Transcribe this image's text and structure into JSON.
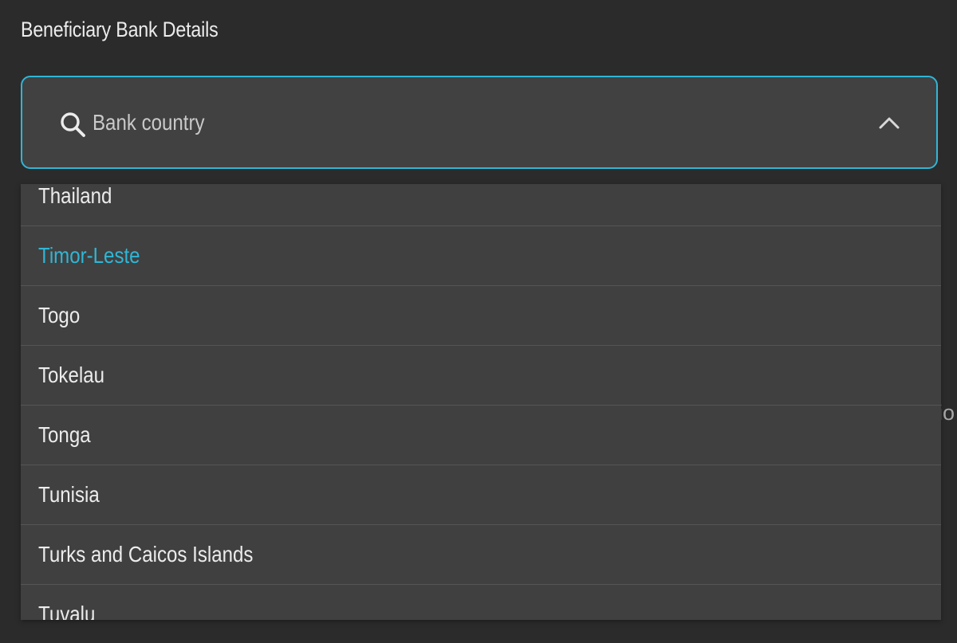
{
  "section": {
    "title": "Beneficiary Bank Details"
  },
  "search": {
    "placeholder": "Bank country",
    "value": "",
    "icon": "search-icon",
    "toggle_icon": "chevron-up-icon",
    "accent_color": "#2fb6d6"
  },
  "dropdown": {
    "selected": "Timor-Leste",
    "items": [
      {
        "label": "Thailand",
        "selected": false
      },
      {
        "label": "Timor-Leste",
        "selected": true
      },
      {
        "label": "Togo",
        "selected": false
      },
      {
        "label": "Tokelau",
        "selected": false
      },
      {
        "label": "Tonga",
        "selected": false
      },
      {
        "label": "Tunisia",
        "selected": false
      },
      {
        "label": "Turks and Caicos Islands",
        "selected": false
      },
      {
        "label": "Tuvalu",
        "selected": false
      }
    ]
  },
  "background": {
    "clipped_text": "io"
  },
  "colors": {
    "page_background": "#2b2b2b",
    "field_background": "#414141",
    "dropdown_background": "#404040",
    "selected_text": "#2fb6d6",
    "text": "#ececec"
  }
}
